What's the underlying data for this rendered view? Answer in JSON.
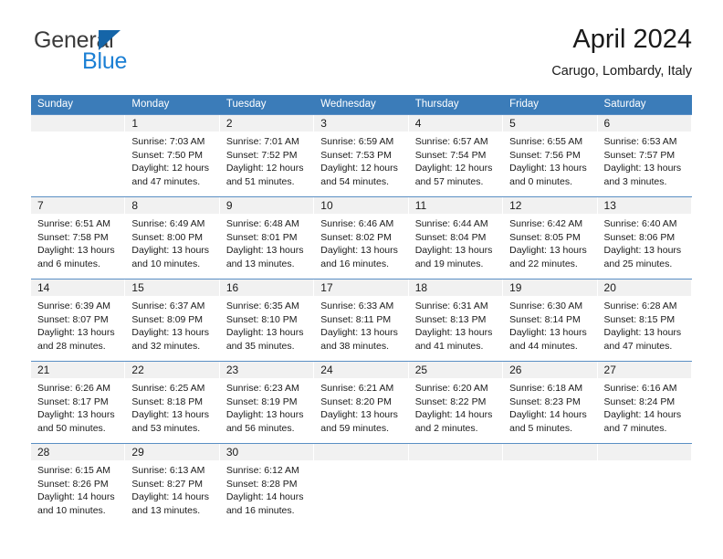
{
  "brand": {
    "name_part1": "General",
    "name_part2": "Blue",
    "triangle_color": "#1565a8",
    "blue_color": "#1b7fd4"
  },
  "header": {
    "title": "April 2024",
    "subtitle": "Carugo, Lombardy, Italy"
  },
  "theme": {
    "header_bg": "#3b7cb9",
    "header_text": "#ffffff",
    "daynum_band_bg": "#f1f1f1",
    "row_divider": "#5a8fc4"
  },
  "weekdays": [
    "Sunday",
    "Monday",
    "Tuesday",
    "Wednesday",
    "Thursday",
    "Friday",
    "Saturday"
  ],
  "weeks": [
    [
      {
        "day": "",
        "sunrise": "",
        "sunset": "",
        "daylight1": "",
        "daylight2": ""
      },
      {
        "day": "1",
        "sunrise": "Sunrise: 7:03 AM",
        "sunset": "Sunset: 7:50 PM",
        "daylight1": "Daylight: 12 hours",
        "daylight2": "and 47 minutes."
      },
      {
        "day": "2",
        "sunrise": "Sunrise: 7:01 AM",
        "sunset": "Sunset: 7:52 PM",
        "daylight1": "Daylight: 12 hours",
        "daylight2": "and 51 minutes."
      },
      {
        "day": "3",
        "sunrise": "Sunrise: 6:59 AM",
        "sunset": "Sunset: 7:53 PM",
        "daylight1": "Daylight: 12 hours",
        "daylight2": "and 54 minutes."
      },
      {
        "day": "4",
        "sunrise": "Sunrise: 6:57 AM",
        "sunset": "Sunset: 7:54 PM",
        "daylight1": "Daylight: 12 hours",
        "daylight2": "and 57 minutes."
      },
      {
        "day": "5",
        "sunrise": "Sunrise: 6:55 AM",
        "sunset": "Sunset: 7:56 PM",
        "daylight1": "Daylight: 13 hours",
        "daylight2": "and 0 minutes."
      },
      {
        "day": "6",
        "sunrise": "Sunrise: 6:53 AM",
        "sunset": "Sunset: 7:57 PM",
        "daylight1": "Daylight: 13 hours",
        "daylight2": "and 3 minutes."
      }
    ],
    [
      {
        "day": "7",
        "sunrise": "Sunrise: 6:51 AM",
        "sunset": "Sunset: 7:58 PM",
        "daylight1": "Daylight: 13 hours",
        "daylight2": "and 6 minutes."
      },
      {
        "day": "8",
        "sunrise": "Sunrise: 6:49 AM",
        "sunset": "Sunset: 8:00 PM",
        "daylight1": "Daylight: 13 hours",
        "daylight2": "and 10 minutes."
      },
      {
        "day": "9",
        "sunrise": "Sunrise: 6:48 AM",
        "sunset": "Sunset: 8:01 PM",
        "daylight1": "Daylight: 13 hours",
        "daylight2": "and 13 minutes."
      },
      {
        "day": "10",
        "sunrise": "Sunrise: 6:46 AM",
        "sunset": "Sunset: 8:02 PM",
        "daylight1": "Daylight: 13 hours",
        "daylight2": "and 16 minutes."
      },
      {
        "day": "11",
        "sunrise": "Sunrise: 6:44 AM",
        "sunset": "Sunset: 8:04 PM",
        "daylight1": "Daylight: 13 hours",
        "daylight2": "and 19 minutes."
      },
      {
        "day": "12",
        "sunrise": "Sunrise: 6:42 AM",
        "sunset": "Sunset: 8:05 PM",
        "daylight1": "Daylight: 13 hours",
        "daylight2": "and 22 minutes."
      },
      {
        "day": "13",
        "sunrise": "Sunrise: 6:40 AM",
        "sunset": "Sunset: 8:06 PM",
        "daylight1": "Daylight: 13 hours",
        "daylight2": "and 25 minutes."
      }
    ],
    [
      {
        "day": "14",
        "sunrise": "Sunrise: 6:39 AM",
        "sunset": "Sunset: 8:07 PM",
        "daylight1": "Daylight: 13 hours",
        "daylight2": "and 28 minutes."
      },
      {
        "day": "15",
        "sunrise": "Sunrise: 6:37 AM",
        "sunset": "Sunset: 8:09 PM",
        "daylight1": "Daylight: 13 hours",
        "daylight2": "and 32 minutes."
      },
      {
        "day": "16",
        "sunrise": "Sunrise: 6:35 AM",
        "sunset": "Sunset: 8:10 PM",
        "daylight1": "Daylight: 13 hours",
        "daylight2": "and 35 minutes."
      },
      {
        "day": "17",
        "sunrise": "Sunrise: 6:33 AM",
        "sunset": "Sunset: 8:11 PM",
        "daylight1": "Daylight: 13 hours",
        "daylight2": "and 38 minutes."
      },
      {
        "day": "18",
        "sunrise": "Sunrise: 6:31 AM",
        "sunset": "Sunset: 8:13 PM",
        "daylight1": "Daylight: 13 hours",
        "daylight2": "and 41 minutes."
      },
      {
        "day": "19",
        "sunrise": "Sunrise: 6:30 AM",
        "sunset": "Sunset: 8:14 PM",
        "daylight1": "Daylight: 13 hours",
        "daylight2": "and 44 minutes."
      },
      {
        "day": "20",
        "sunrise": "Sunrise: 6:28 AM",
        "sunset": "Sunset: 8:15 PM",
        "daylight1": "Daylight: 13 hours",
        "daylight2": "and 47 minutes."
      }
    ],
    [
      {
        "day": "21",
        "sunrise": "Sunrise: 6:26 AM",
        "sunset": "Sunset: 8:17 PM",
        "daylight1": "Daylight: 13 hours",
        "daylight2": "and 50 minutes."
      },
      {
        "day": "22",
        "sunrise": "Sunrise: 6:25 AM",
        "sunset": "Sunset: 8:18 PM",
        "daylight1": "Daylight: 13 hours",
        "daylight2": "and 53 minutes."
      },
      {
        "day": "23",
        "sunrise": "Sunrise: 6:23 AM",
        "sunset": "Sunset: 8:19 PM",
        "daylight1": "Daylight: 13 hours",
        "daylight2": "and 56 minutes."
      },
      {
        "day": "24",
        "sunrise": "Sunrise: 6:21 AM",
        "sunset": "Sunset: 8:20 PM",
        "daylight1": "Daylight: 13 hours",
        "daylight2": "and 59 minutes."
      },
      {
        "day": "25",
        "sunrise": "Sunrise: 6:20 AM",
        "sunset": "Sunset: 8:22 PM",
        "daylight1": "Daylight: 14 hours",
        "daylight2": "and 2 minutes."
      },
      {
        "day": "26",
        "sunrise": "Sunrise: 6:18 AM",
        "sunset": "Sunset: 8:23 PM",
        "daylight1": "Daylight: 14 hours",
        "daylight2": "and 5 minutes."
      },
      {
        "day": "27",
        "sunrise": "Sunrise: 6:16 AM",
        "sunset": "Sunset: 8:24 PM",
        "daylight1": "Daylight: 14 hours",
        "daylight2": "and 7 minutes."
      }
    ],
    [
      {
        "day": "28",
        "sunrise": "Sunrise: 6:15 AM",
        "sunset": "Sunset: 8:26 PM",
        "daylight1": "Daylight: 14 hours",
        "daylight2": "and 10 minutes."
      },
      {
        "day": "29",
        "sunrise": "Sunrise: 6:13 AM",
        "sunset": "Sunset: 8:27 PM",
        "daylight1": "Daylight: 14 hours",
        "daylight2": "and 13 minutes."
      },
      {
        "day": "30",
        "sunrise": "Sunrise: 6:12 AM",
        "sunset": "Sunset: 8:28 PM",
        "daylight1": "Daylight: 14 hours",
        "daylight2": "and 16 minutes."
      },
      {
        "day": "",
        "sunrise": "",
        "sunset": "",
        "daylight1": "",
        "daylight2": ""
      },
      {
        "day": "",
        "sunrise": "",
        "sunset": "",
        "daylight1": "",
        "daylight2": ""
      },
      {
        "day": "",
        "sunrise": "",
        "sunset": "",
        "daylight1": "",
        "daylight2": ""
      },
      {
        "day": "",
        "sunrise": "",
        "sunset": "",
        "daylight1": "",
        "daylight2": ""
      }
    ]
  ]
}
